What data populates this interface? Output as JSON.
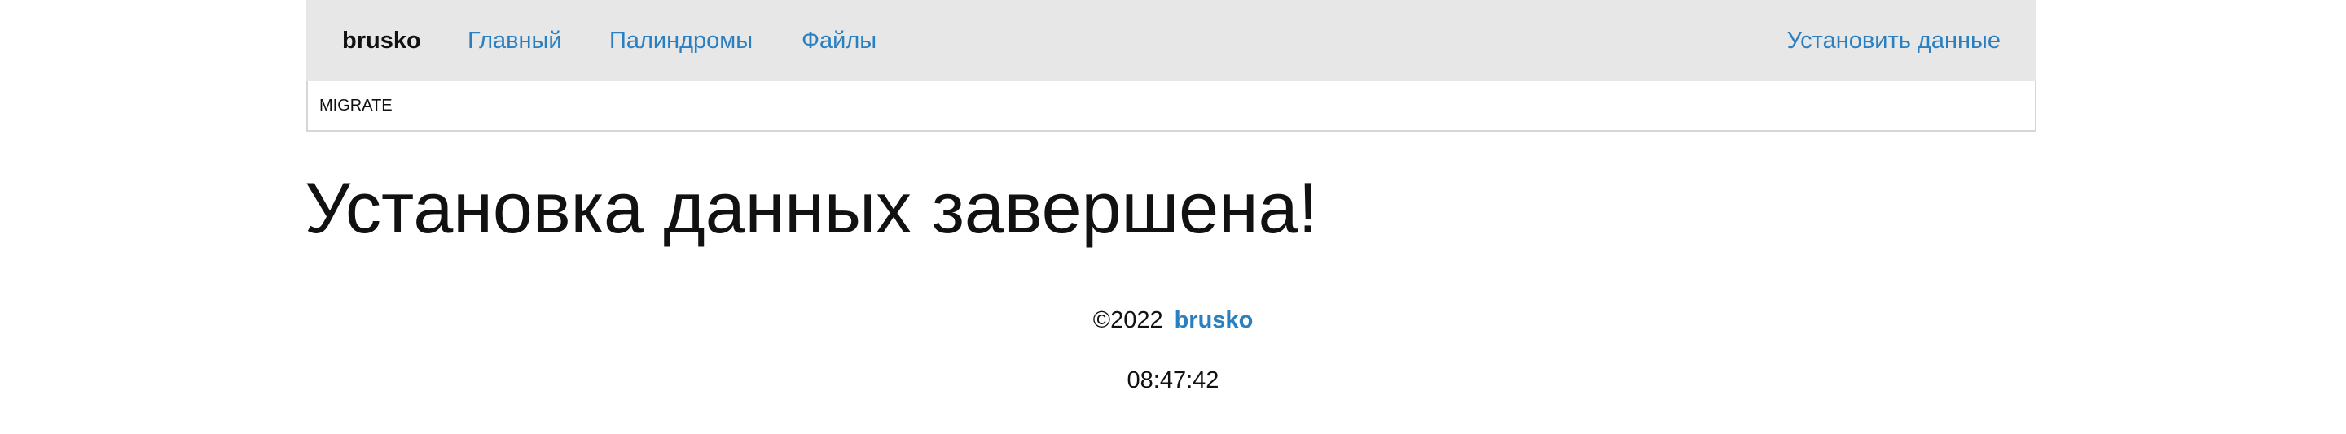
{
  "navbar": {
    "brand": "brusko",
    "links": {
      "home": "Главный",
      "palindromes": "Палиндромы",
      "files": "Файлы",
      "install": "Установить данные"
    }
  },
  "subbar": {
    "migrate_label": "MIGRATE"
  },
  "main": {
    "title": "Установка данных завершена!"
  },
  "footer": {
    "copyright": "©2022",
    "owner": "brusko",
    "time": "08:47:42"
  },
  "colors": {
    "link": "#2a7fc0",
    "navbar_bg": "#e7e7e7",
    "text": "#111111"
  }
}
